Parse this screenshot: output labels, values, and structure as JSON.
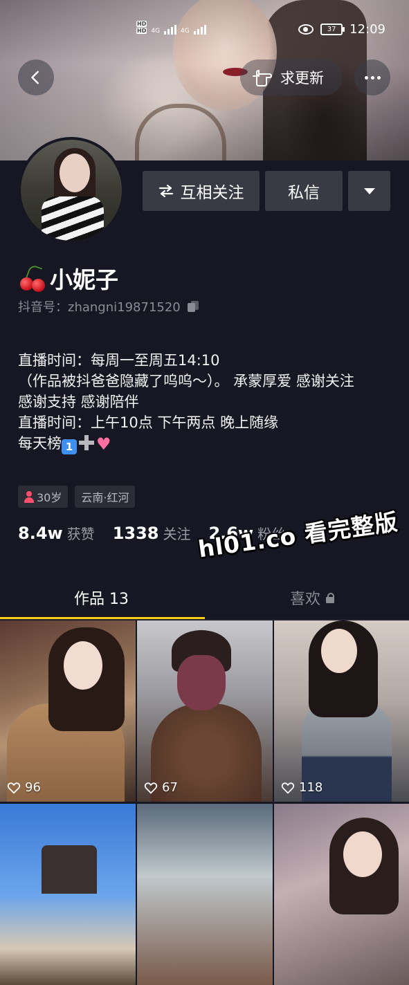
{
  "status_bar": {
    "hd1": "HD",
    "hd2": "HD",
    "net1": "4G",
    "net2": "4G",
    "battery": "37",
    "time": "12:09"
  },
  "header": {
    "back_icon": "chevron-left-icon",
    "request_update_label": "求更新",
    "request_update_icon": "pointing-hand-icon",
    "more_icon": "more-dots-icon"
  },
  "profile": {
    "action_follow_label": "互相关注",
    "action_follow_icon": "swap-arrows-icon",
    "action_message_label": "私信",
    "action_dropdown_icon": "triangle-down-icon",
    "name_emoji": "cherry-icon",
    "name": "小妮子",
    "douyin_id": "抖音号：zhangni19871520",
    "bio_lines": [
      "直播时间：每周一至周五14:10",
      "（作品被抖爸爸隐藏了呜呜～）。   承蒙厚爱 感谢关注",
      "感谢支持 感谢陪伴",
      "直播时间：上午10点 下午两点 晚上随缘",
      "每天榜"
    ],
    "bio_emoji_number": "1",
    "tags": {
      "age": "30岁",
      "location": "云南·红河"
    },
    "stats": {
      "likes_num": "8.4w",
      "likes_label": "获赞",
      "following_num": "1338",
      "following_label": "关注",
      "fans_num": "2.6w",
      "fans_label": "粉丝"
    }
  },
  "watermark": "hl01.co 看完整版",
  "tabs": {
    "works": "作品 13",
    "likes": "喜欢"
  },
  "videos": [
    {
      "likes": "96"
    },
    {
      "likes": "67"
    },
    {
      "likes": "118"
    },
    {
      "likes": ""
    },
    {
      "likes": ""
    },
    {
      "likes": ""
    }
  ],
  "colors": {
    "background": "#161722",
    "button": "#393a44",
    "tab_indicator": "#face15",
    "muted_text": "#8a8b93"
  }
}
